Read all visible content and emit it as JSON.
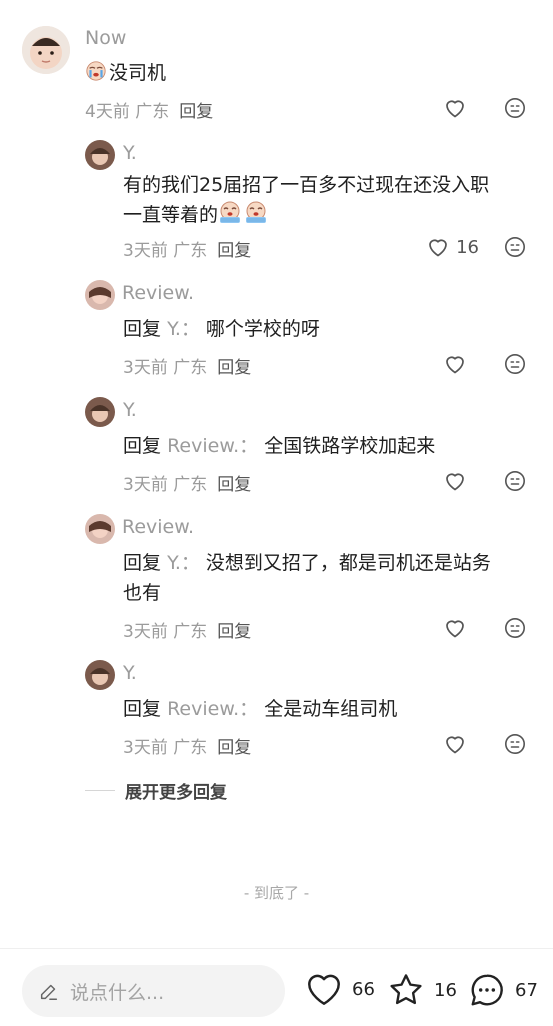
{
  "thread": {
    "top": {
      "author": "Now",
      "text": "没司机",
      "time_location": "4天前 广东",
      "reply_label": "回复"
    },
    "replies": [
      {
        "author": "Y.",
        "line1": "有的我们25届招了一百多不过现在还没入职",
        "line2": "一直等着的",
        "time_location": "3天前 广东",
        "reply_label": "回复",
        "likes": "16"
      },
      {
        "author": "Review.",
        "reply_word": "回复",
        "reply_to": "Y.：",
        "text": "哪个学校的呀",
        "time_location": "3天前 广东",
        "reply_label": "回复"
      },
      {
        "author": "Y.",
        "reply_word": "回复",
        "reply_to": "Review.：",
        "text": "全国铁路学校加起来",
        "time_location": "3天前 广东",
        "reply_label": "回复"
      },
      {
        "author": "Review.",
        "reply_word": "回复",
        "reply_to": "Y.：",
        "text": "没想到又招了，都是司机还是站务",
        "line2": "也有",
        "time_location": "3天前 广东",
        "reply_label": "回复"
      },
      {
        "author": "Y.",
        "reply_word": "回复",
        "reply_to": "Review.：",
        "text": "全是动车组司机",
        "time_location": "3天前 广东",
        "reply_label": "回复"
      }
    ],
    "expand_label": "展开更多回复"
  },
  "end_label": "- 到底了 -",
  "bottom_bar": {
    "input_placeholder": "说点什么...",
    "likes": "66",
    "stars": "16",
    "comments": "67"
  }
}
